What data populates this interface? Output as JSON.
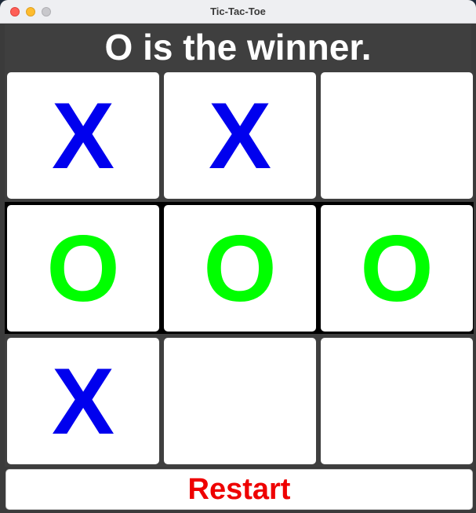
{
  "window": {
    "title": "Tic-Tac-Toe"
  },
  "status": {
    "text": "O is the winner."
  },
  "board": {
    "rows": [
      [
        "X",
        "X",
        ""
      ],
      [
        "O",
        "O",
        "O"
      ],
      [
        "X",
        "",
        ""
      ]
    ]
  },
  "restart": {
    "label": "Restart"
  },
  "colors": {
    "x_mark": "#0000ee",
    "o_mark": "#00ff00",
    "status_bg": "#3f3f3f",
    "status_text": "#ffffff",
    "restart_text": "#ee0000",
    "winning_row_bg": "#000000"
  },
  "icons": {
    "close": "close-traffic-light-icon",
    "minimize": "minimize-traffic-light-icon",
    "zoom": "zoom-traffic-light-icon"
  }
}
